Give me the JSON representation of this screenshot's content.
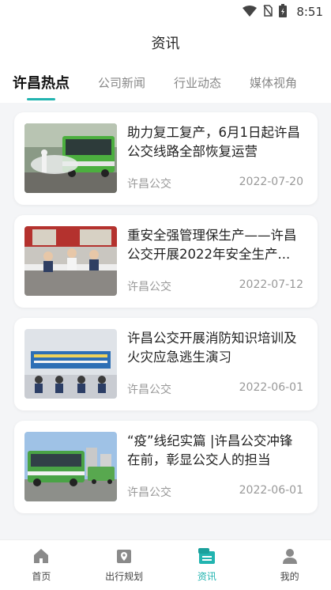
{
  "status_bar": {
    "time": "8:51"
  },
  "header": {
    "title": "资讯"
  },
  "tabs": [
    {
      "label": "许昌热点",
      "active": true
    },
    {
      "label": "公司新闻",
      "active": false
    },
    {
      "label": "行业动态",
      "active": false
    },
    {
      "label": "媒体视角",
      "active": false
    }
  ],
  "news": [
    {
      "title": "助力复工复产，6月1日起许昌公交线路全部恢复运营",
      "source": "许昌公交",
      "date": "2022-07-20",
      "thumb_icon": "bus-disinfection-photo"
    },
    {
      "title": "重安全强管理保生产——许昌公交开展2022年安全生产...",
      "source": "许昌公交",
      "date": "2022-07-12",
      "thumb_icon": "meeting-photo"
    },
    {
      "title": "许昌公交开展消防知识培训及火灾应急逃生演习",
      "source": "许昌公交",
      "date": "2022-06-01",
      "thumb_icon": "training-photo"
    },
    {
      "title": "“疫”线纪实篇 |许昌公交冲锋在前，彰显公交人的担当",
      "source": "许昌公交",
      "date": "2022-06-01",
      "thumb_icon": "buses-photo"
    }
  ],
  "bottom_nav": [
    {
      "label": "首页",
      "icon": "home-icon",
      "active": false
    },
    {
      "label": "出行规划",
      "icon": "map-icon",
      "active": false
    },
    {
      "label": "资讯",
      "icon": "news-icon",
      "active": true
    },
    {
      "label": "我的",
      "icon": "profile-icon",
      "active": false
    }
  ],
  "colors": {
    "accent": "#22b4b0",
    "background": "#f4f5f7"
  }
}
